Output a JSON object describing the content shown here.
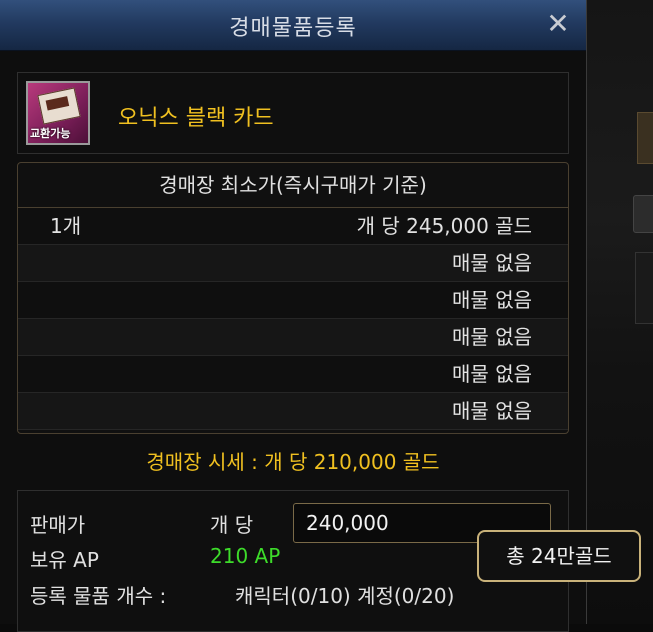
{
  "window": {
    "title": "경매물품등록",
    "close_label": "✕"
  },
  "item": {
    "name": "오닉스 블랙 카드",
    "icon_tag": "교환가능"
  },
  "price_table": {
    "header": "경매장 최소가(즉시구매가 기준)",
    "rows": [
      {
        "qty": "1개",
        "price": "개 당 245,000 골드"
      },
      {
        "qty": "",
        "price": "매물 없음"
      },
      {
        "qty": "",
        "price": "매물 없음"
      },
      {
        "qty": "",
        "price": "매물 없음"
      },
      {
        "qty": "",
        "price": "매물 없음"
      },
      {
        "qty": "",
        "price": "매물 없음"
      }
    ]
  },
  "market_price": "경매장 시세 : 개 당 210,000 골드",
  "sell": {
    "price_label": "판매가",
    "per_unit_label": "개 당",
    "price_value": "240,000",
    "ap_label": "보유 AP",
    "ap_value": "210 AP",
    "count_label": "등록 물품 개수 :",
    "count_value": "캐릭터(0/10) 계정(0/20)"
  },
  "tooltip": "총 24만골드",
  "colors": {
    "gold_text": "#f0c020",
    "ap_green": "#3ddc2a",
    "title_bar": "#223a60"
  }
}
